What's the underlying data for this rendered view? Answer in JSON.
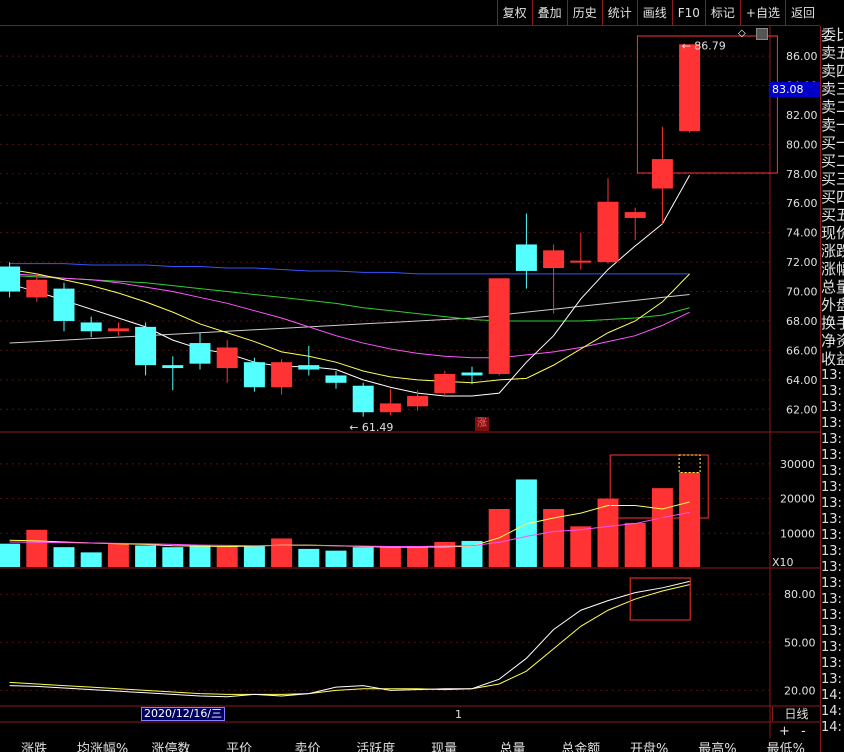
{
  "toolbar": {
    "buttons": [
      "复权",
      "叠加",
      "历史",
      "统计",
      "画线",
      "F10",
      "标记",
      "+自选",
      "返回"
    ]
  },
  "right_panel": {
    "labels": [
      "委比",
      "卖五",
      "卖四",
      "卖三",
      "卖二",
      "卖一",
      "买一",
      "买二",
      "买三",
      "买四",
      "买五",
      "现价",
      "涨跌",
      "涨幅",
      "总量",
      "外盘",
      "换手",
      "净资",
      "收益"
    ],
    "times": [
      "13:",
      "13:",
      "13:",
      "13:",
      "13:",
      "13:",
      "13:",
      "13:",
      "13:",
      "13:",
      "13:",
      "13:",
      "13:",
      "13:",
      "13:",
      "13:",
      "13:",
      "13:",
      "13:",
      "13:",
      "14:",
      "14:",
      "14:"
    ]
  },
  "price_axis": {
    "ticks": [
      "86.00",
      "84.00",
      "82.00",
      "80.00",
      "78.00",
      "76.00",
      "74.00",
      "72.00",
      "70.00",
      "68.00",
      "66.00",
      "64.00",
      "62.00"
    ],
    "current_price": "83.08",
    "high_label": "86.79",
    "low_label": "61.49",
    "range": [
      61,
      87.5
    ]
  },
  "volume_axis": {
    "ticks": [
      "30000",
      "20000",
      "10000"
    ],
    "multiplier": "X10",
    "range": [
      0,
      36000
    ]
  },
  "indicator_axis": {
    "ticks": [
      "80.00",
      "50.00",
      "20.00"
    ],
    "range": [
      14,
      92
    ]
  },
  "date_label": "2020/12/16/三",
  "rise_mark": "涨",
  "cursor_label": "1",
  "daily_label": "日线",
  "plus_label": "+",
  "minus_label": "-",
  "colors": {
    "up": "#ff3333",
    "down": "#54ffff",
    "ma5": "#ffffff",
    "ma10": "#ffff55",
    "ma20": "#ff55ff",
    "ma30": "#33cc33",
    "ma60": "#3355ff",
    "ma120": "#cccccc"
  },
  "footer": {
    "columns": [
      "涨跌",
      "均涨幅%",
      "涨停数",
      "平价",
      "卖价",
      "活跃度",
      "现量",
      "总量",
      "总金额",
      "开盘%",
      "最高%",
      "最低%"
    ]
  },
  "chart_data": {
    "type": "candlestick",
    "candles": [
      {
        "o": 71.7,
        "c": 70.0,
        "h": 72.0,
        "l": 69.6
      },
      {
        "o": 69.6,
        "c": 70.8,
        "h": 71.2,
        "l": 69.3
      },
      {
        "o": 70.2,
        "c": 68.0,
        "h": 70.6,
        "l": 67.3
      },
      {
        "o": 67.9,
        "c": 67.3,
        "h": 68.3,
        "l": 66.9
      },
      {
        "o": 67.3,
        "c": 67.5,
        "h": 67.9,
        "l": 67.0
      },
      {
        "o": 67.6,
        "c": 65.0,
        "h": 67.9,
        "l": 64.3
      },
      {
        "o": 65.0,
        "c": 64.8,
        "h": 65.6,
        "l": 63.3
      },
      {
        "o": 66.5,
        "c": 65.1,
        "h": 67.2,
        "l": 64.7
      },
      {
        "o": 64.8,
        "c": 66.2,
        "h": 66.7,
        "l": 63.8
      },
      {
        "o": 65.2,
        "c": 63.5,
        "h": 65.5,
        "l": 63.2
      },
      {
        "o": 63.5,
        "c": 65.2,
        "h": 65.4,
        "l": 63.0
      },
      {
        "o": 65.0,
        "c": 64.7,
        "h": 66.3,
        "l": 64.3
      },
      {
        "o": 64.3,
        "c": 63.8,
        "h": 64.6,
        "l": 63.4
      },
      {
        "o": 63.6,
        "c": 61.8,
        "h": 63.8,
        "l": 61.5
      },
      {
        "o": 61.8,
        "c": 62.4,
        "h": 63.4,
        "l": 61.6
      },
      {
        "o": 62.2,
        "c": 62.9,
        "h": 63.3,
        "l": 61.9
      },
      {
        "o": 63.1,
        "c": 64.4,
        "h": 64.6,
        "l": 62.9
      },
      {
        "o": 64.5,
        "c": 64.3,
        "h": 64.9,
        "l": 63.7
      },
      {
        "o": 64.4,
        "c": 70.9,
        "h": 70.9,
        "l": 64.3
      },
      {
        "o": 73.2,
        "c": 71.4,
        "h": 75.3,
        "l": 70.2
      },
      {
        "o": 71.6,
        "c": 72.8,
        "h": 73.2,
        "l": 68.5
      },
      {
        "o": 72.0,
        "c": 72.1,
        "h": 74.0,
        "l": 71.5
      },
      {
        "o": 72.0,
        "c": 76.1,
        "h": 77.7,
        "l": 71.9
      },
      {
        "o": 75.0,
        "c": 75.4,
        "h": 75.7,
        "l": 73.5
      },
      {
        "o": 77.0,
        "c": 79.0,
        "h": 81.2,
        "l": 74.6
      },
      {
        "o": 80.9,
        "c": 86.8,
        "h": 86.79,
        "l": 80.8
      }
    ],
    "ma5": [
      70.5,
      70.0,
      69.4,
      68.8,
      68.2,
      67.6,
      66.7,
      66.1,
      65.8,
      65.2,
      64.9,
      64.9,
      64.7,
      64.0,
      63.5,
      63.1,
      62.9,
      62.9,
      63.1,
      65.2,
      67.0,
      69.5,
      71.5,
      73.1,
      74.6,
      77.9
    ],
    "ma10": [
      71.5,
      71.2,
      70.8,
      70.4,
      69.9,
      69.3,
      68.6,
      67.8,
      67.2,
      66.6,
      65.9,
      65.6,
      65.2,
      64.6,
      64.2,
      64.0,
      63.9,
      63.8,
      64.0,
      64.1,
      65.0,
      66.1,
      67.2,
      68.0,
      69.3,
      71.2
    ],
    "ma20": [
      71.2,
      71.1,
      70.9,
      70.8,
      70.6,
      70.3,
      70.0,
      69.6,
      69.2,
      68.7,
      68.2,
      67.6,
      67.0,
      66.5,
      66.1,
      65.8,
      65.6,
      65.5,
      65.5,
      65.7,
      65.9,
      66.2,
      66.6,
      67.0,
      67.7,
      68.6
    ],
    "ma30": [
      71.1,
      71.0,
      70.9,
      70.8,
      70.7,
      70.6,
      70.4,
      70.2,
      70.0,
      69.8,
      69.6,
      69.4,
      69.2,
      68.9,
      68.7,
      68.5,
      68.3,
      68.1,
      68.0,
      68.0,
      68.0,
      68.0,
      68.1,
      68.2,
      68.4,
      68.9
    ],
    "ma60": [
      71.9,
      71.9,
      71.9,
      71.8,
      71.8,
      71.8,
      71.7,
      71.7,
      71.6,
      71.6,
      71.5,
      71.4,
      71.4,
      71.3,
      71.3,
      71.2,
      71.2,
      71.2,
      71.2,
      71.2,
      71.2,
      71.2,
      71.2,
      71.2,
      71.2,
      71.2
    ],
    "ma120": [
      66.5,
      66.6,
      66.7,
      66.8,
      66.9,
      67.0,
      67.1,
      67.2,
      67.3,
      67.4,
      67.5,
      67.6,
      67.7,
      67.8,
      67.9,
      68.0,
      68.1,
      68.2,
      68.4,
      68.6,
      68.8,
      69.0,
      69.2,
      69.4,
      69.6,
      69.8
    ],
    "volume": [
      7000,
      11000,
      6000,
      4500,
      7000,
      6500,
      6000,
      6500,
      6200,
      6300,
      8500,
      5500,
      5000,
      6000,
      6000,
      6000,
      7500,
      7800,
      17000,
      25500,
      17000,
      12000,
      20000,
      13000,
      23000,
      27500
    ],
    "vol_ma5": [
      8000,
      7800,
      7500,
      7200,
      7000,
      6800,
      6400,
      6300,
      6200,
      6300,
      6600,
      6600,
      6400,
      6200,
      6000,
      6000,
      6100,
      6300,
      8700,
      12700,
      14400,
      15800,
      18000,
      18000,
      17000,
      19000
    ],
    "vol_ma10": [
      7500,
      7400,
      7300,
      7200,
      7100,
      7000,
      6800,
      6600,
      6500,
      6400,
      6500,
      6500,
      6400,
      6300,
      6200,
      6200,
      6300,
      6400,
      7400,
      9100,
      10500,
      11000,
      12000,
      12800,
      14500,
      16000
    ],
    "ind_k": [
      23,
      22.5,
      21.5,
      20.5,
      19.5,
      18.5,
      17.5,
      16.5,
      16,
      17.5,
      16.5,
      18,
      22,
      23,
      20,
      20.5,
      21,
      21,
      27,
      40,
      58,
      70,
      76,
      81,
      84,
      88
    ],
    "ind_d": [
      25,
      24,
      23,
      22,
      21,
      20,
      19,
      18,
      17.5,
      17.5,
      17.5,
      18,
      20,
      21,
      21,
      21,
      20.5,
      21,
      24,
      32,
      46,
      60,
      70,
      77,
      82,
      86
    ]
  }
}
